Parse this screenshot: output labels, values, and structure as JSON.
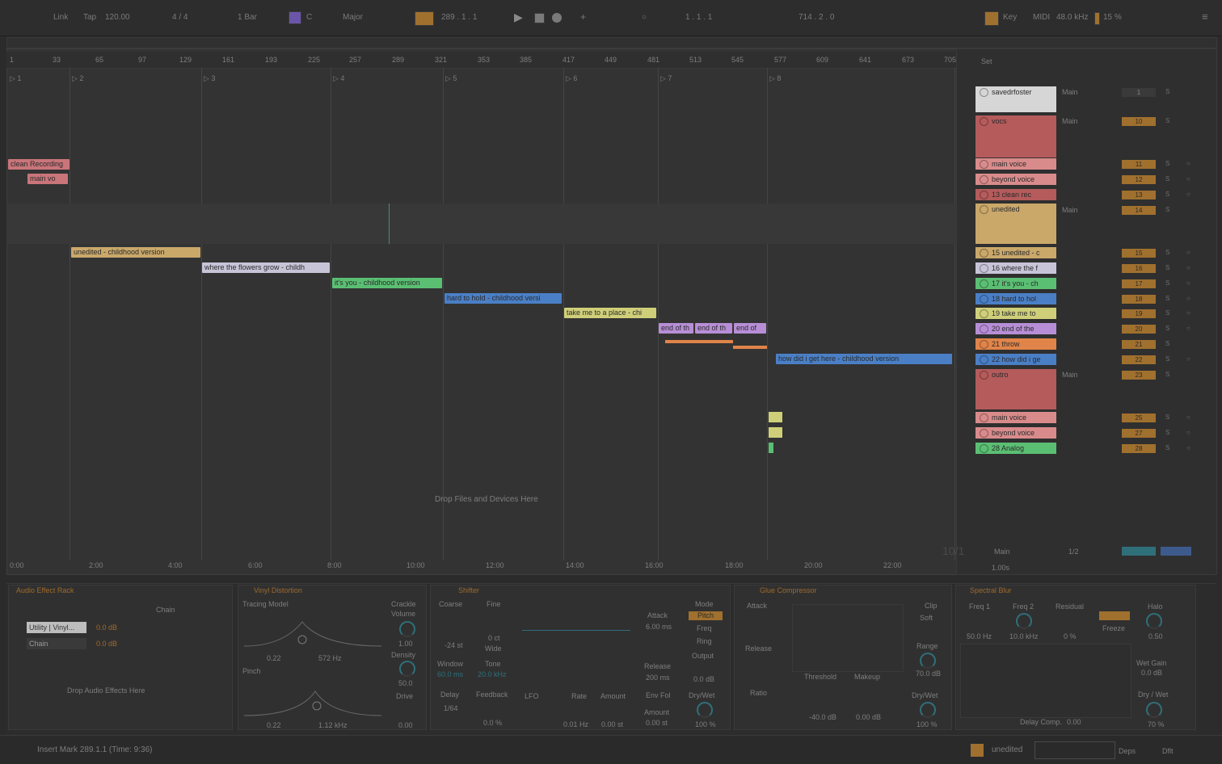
{
  "topbar": {
    "link": "Link",
    "tap": "Tap",
    "tempo": "120.00",
    "signature": "4 / 4",
    "quantize": "1 Bar",
    "key": "C",
    "scale": "Major",
    "position": "289 .   1 .   1",
    "loop_start": "1 .   1 .   1",
    "loop_length": "714 .   2 .   0",
    "key_map": "Key",
    "midi": "MIDI",
    "sample_rate": "48.0 kHz",
    "cpu": "15 %"
  },
  "ruler": [
    "1",
    "33",
    "65",
    "97",
    "129",
    "161",
    "193",
    "225",
    "257",
    "289",
    "321",
    "353",
    "385",
    "417",
    "449",
    "481",
    "513",
    "545",
    "577",
    "609",
    "641",
    "673",
    "705"
  ],
  "markers": [
    "1",
    "2",
    "3",
    "4",
    "5",
    "6",
    "7",
    "8"
  ],
  "clips": [
    {
      "label": "clean Recording",
      "color": "#c9757a"
    },
    {
      "label": "main vo",
      "color": "#c9757a"
    },
    {
      "label": "unedited - childhood version",
      "color": "#caa86a"
    },
    {
      "label": "where the flowers grow - childh",
      "color": "#c8c4d8"
    },
    {
      "label": "it's you - childhood version",
      "color": "#5bbf73"
    },
    {
      "label": "hard to hold - childhood versi",
      "color": "#4a7fc6"
    },
    {
      "label": "take me to a place - chi",
      "color": "#cfcf7a"
    },
    {
      "label": "end of th",
      "color": "#b78ed6"
    },
    {
      "label": "end of th",
      "color": "#b78ed6"
    },
    {
      "label": "end of",
      "color": "#b78ed6"
    },
    {
      "label": "how did i get here - childhood version",
      "color": "#4a7fc6"
    }
  ],
  "drop_hint": "Drop Files and Devices Here",
  "time_axis": [
    "0:00",
    "2:00",
    "4:00",
    "6:00",
    "8:00",
    "10:00",
    "12:00",
    "14:00",
    "16:00",
    "18:00",
    "20:00",
    "22:00"
  ],
  "mixer": {
    "set_label": "Set",
    "routing": "Main",
    "tracks": [
      {
        "name": "savedrfoster",
        "color": "#d6d6d6",
        "num": "1"
      },
      {
        "name": "vocs",
        "color": "#b55b5b",
        "num": "10"
      },
      {
        "name": "main voice",
        "color": "#d98b8b",
        "num": "11"
      },
      {
        "name": "beyond voice",
        "color": "#d98b8b",
        "num": "12"
      },
      {
        "name": "13 clean rec",
        "color": "#b55b5b",
        "num": "13"
      },
      {
        "name": "unedited",
        "color": "#caa86a",
        "num": "14"
      },
      {
        "name": "15 unedited - c",
        "color": "#caa86a",
        "num": "15"
      },
      {
        "name": "16 where the f",
        "color": "#c8c4d8",
        "num": "16"
      },
      {
        "name": "17 it's you - ch",
        "color": "#5bbf73",
        "num": "17"
      },
      {
        "name": "18 hard to hol",
        "color": "#4a7fc6",
        "num": "18"
      },
      {
        "name": "19 take me to",
        "color": "#cfcf7a",
        "num": "19"
      },
      {
        "name": "20 end of the",
        "color": "#b78ed6",
        "num": "20"
      },
      {
        "name": "21 throw",
        "color": "#e0844a",
        "num": "21"
      },
      {
        "name": "22 how did i ge",
        "color": "#4a7fc6",
        "num": "22"
      },
      {
        "name": "outro",
        "color": "#b55b5b",
        "num": "23"
      },
      {
        "name": "main voice",
        "color": "#d98b8b",
        "num": "25"
      },
      {
        "name": "beyond voice",
        "color": "#d98b8b",
        "num": "27"
      },
      {
        "name": "28 Analog",
        "color": "#5bbf73",
        "num": "28"
      }
    ],
    "master_label": "Main",
    "master_count": "10/1",
    "fraction": "1/2",
    "bottom_val": "1.00s"
  },
  "devices": {
    "rack": {
      "title": "Audio Effect Rack",
      "chain": "Chain",
      "chain1": "Utility | Vinyl...",
      "chain1_val": "0.0 dB",
      "chain2": "Chain",
      "chain2_val": "0.0 dB",
      "drop": "Drop Audio Effects Here"
    },
    "vinyl": {
      "title": "Vinyl Distortion",
      "tracing": "Tracing Model",
      "crackle": "Crackle",
      "volume": "Volume",
      "vol_val": "1.00",
      "density": "Density",
      "density_val": "50.0",
      "drive": "Drive",
      "drive_val": "0.00",
      "freq1": "572 Hz",
      "freq2": "1.12 kHz",
      "on1": "0.22",
      "on2": "0.22",
      "pinch": "Pinch"
    },
    "shifter": {
      "title": "Shifter",
      "coarse": "Coarse",
      "fine": "Fine",
      "coarse_val": "-24 st",
      "fine_val": "0 ct",
      "wide": "Wide",
      "window": "Window",
      "window_val": "60.0 ms",
      "tone": "Tone",
      "tone_val": "20.0 kHz",
      "delay": "Delay",
      "delay_val": "1/64",
      "feedback": "Feedback",
      "feedback_val": "0.0 %",
      "lfo": "LFO",
      "rate": "Rate",
      "rate_val": "0.01 Hz",
      "amount": "Amount",
      "amount_val": "0.00 st",
      "attack": "Attack",
      "attack_val": "6.00 ms",
      "release": "Release",
      "release_val": "200 ms",
      "envfol": "Env Fol",
      "amount2": "Amount",
      "amount2_val": "0.00 st",
      "mode": "Mode",
      "mode_val": "Pitch",
      "freq": "Freq",
      "ring": "Ring",
      "output": "Output",
      "output_val": "0.0 dB",
      "drywet": "Dry/Wet",
      "drywet_val": "100 %"
    },
    "glue": {
      "title": "Glue Compressor",
      "attack": "Attack",
      "release": "Release",
      "ratio": "Ratio",
      "threshold": "Threshold",
      "threshold_val": "-40.0 dB",
      "makeup": "Makeup",
      "makeup_val": "0.00 dB",
      "clip": "Clip",
      "soft": "Soft",
      "range": "Range",
      "range_val": "70.0 dB",
      "drywet": "Dry/Wet",
      "drywet_val": "100 %"
    },
    "spectral": {
      "title": "Spectral Blur",
      "freq1": "Freq 1",
      "freq1_val": "50.0 Hz",
      "freq2": "Freq 2",
      "freq2_val": "10.0 kHz",
      "residual": "Residual",
      "residual_val": "0 %",
      "freeze": "Freeze",
      "halo": "Halo",
      "halo_val": "0.50",
      "wetgain": "Wet Gain",
      "wetgain_val": "0.0 dB",
      "drywet": "Dry / Wet",
      "drywet_val": "70 %",
      "delay_comp": "Delay Comp.",
      "delay_val": "0.00"
    }
  },
  "status": {
    "message": "Insert Mark 289.1.1 (Time: 9:36)",
    "track": "unedited",
    "deps": "Deps",
    "dflt": "Dflt"
  }
}
